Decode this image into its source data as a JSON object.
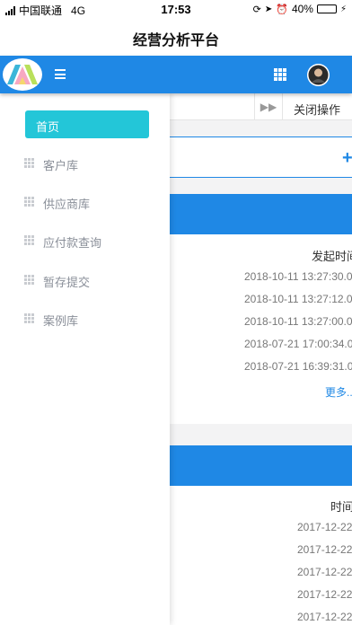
{
  "status_bar": {
    "carrier": "中国联通",
    "network": "4G",
    "time": "17:53",
    "battery": "40%",
    "battery_level": 0.4
  },
  "navbar": {
    "title": "经营分析平台"
  },
  "header": {
    "menu_icon": "hamburger-icon",
    "apps_icon": "grid-icon",
    "avatar_icon": "user-avatar"
  },
  "tabs": {
    "forward_icon": "double-chevron-right-icon",
    "close_label": "关闭操作"
  },
  "sidebar": {
    "items": [
      {
        "label": "首页",
        "active": true
      },
      {
        "label": "客户库"
      },
      {
        "label": "供应商库"
      },
      {
        "label": "应付款查询"
      },
      {
        "label": "暂存提交"
      },
      {
        "label": "案例库"
      }
    ]
  },
  "filter": {
    "add_icon": "plus-icon"
  },
  "panel1": {
    "column_header": "发起时间",
    "rows": [
      "2018-10-11 13:27:30.0",
      "2018-10-11 13:27:12.0",
      "2018-10-11 13:27:00.0",
      "2018-07-21 17:00:34.0",
      "2018-07-21 16:39:31.0"
    ],
    "more_label": "更多..."
  },
  "panel2": {
    "column_header": "时间",
    "rows": [
      "2017-12-22",
      "2017-12-22",
      "2017-12-22",
      "2017-12-22",
      "2017-12-22"
    ]
  },
  "colors": {
    "header_blue": "#1f88e5",
    "active_teal": "#23c6d8",
    "sidebar_text": "#8a8f99"
  }
}
